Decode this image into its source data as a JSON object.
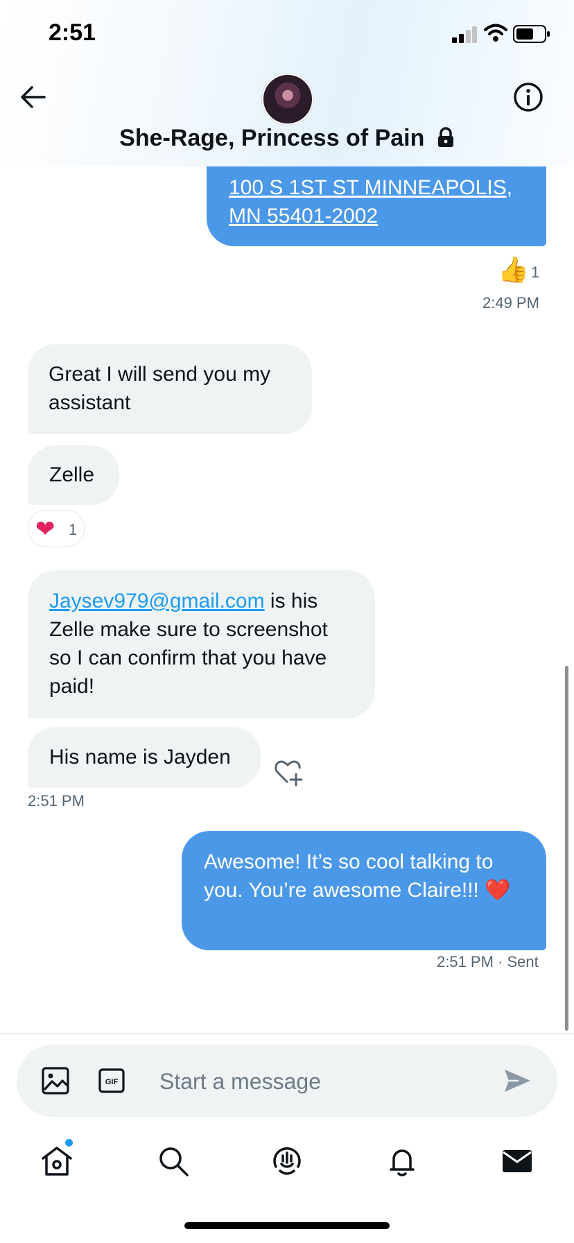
{
  "status_bar": {
    "time": "2:51"
  },
  "header": {
    "title": "She-Rage, Princess of Pain"
  },
  "messages": [
    {
      "direction": "outgoing",
      "text": "100 S 1ST ST MINNEAPOLIS, MN 55401-2002",
      "reaction": {
        "emoji": "👍",
        "count": "1"
      },
      "timestamp": "2:49 PM"
    },
    {
      "direction": "incoming",
      "text": "Great I will send you my assistant"
    },
    {
      "direction": "incoming",
      "text": "Zelle",
      "reaction": {
        "emoji": "❤",
        "count": "1"
      }
    },
    {
      "direction": "incoming",
      "link": "Jaysev979@gmail.com",
      "text": " is his Zelle make sure to screenshot so I can confirm that you have paid!"
    },
    {
      "direction": "incoming",
      "text": "His name is Jayden",
      "timestamp": "2:51 PM"
    },
    {
      "direction": "outgoing",
      "text": "Awesome! It’s so cool talking to you. You’re awesome Claire!!! ❤️",
      "timestamp": "2:51 PM",
      "status": "· Sent"
    }
  ],
  "composer": {
    "placeholder": "Start a message"
  },
  "nav": [
    "home-icon",
    "search-icon",
    "spaces-icon",
    "notifications-icon",
    "messages-icon"
  ],
  "colors": {
    "outgoing_bubble": "#4c98e8",
    "incoming_bubble": "#eff3f4",
    "link": "#1d9bf0",
    "reaction_heart": "#e0245e"
  }
}
